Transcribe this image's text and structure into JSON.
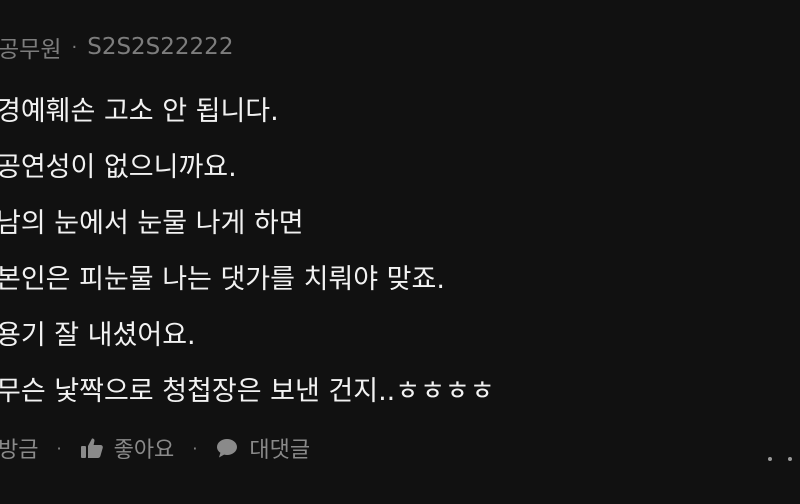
{
  "comment": {
    "author": "공무원",
    "separator": "·",
    "user_id": "S2S2S22222",
    "lines": [
      "경예훼손 고소 안 됩니다.",
      "공연성이 없으니까요.",
      "남의 눈에서 눈물 나게 하면",
      "본인은 피눈물 나는 댓가를 치뤄야 맞죠.",
      "용기 잘 내셨어요.",
      "무슨 낯짝으로 청첩장은 보낸 건지..ㅎㅎㅎㅎ"
    ],
    "timestamp": "방금",
    "like_label": "좋아요",
    "reply_label": "대댓글",
    "icons": {
      "like": "thumbs-up-icon",
      "reply": "speech-bubble-icon",
      "more": "more-dots-icon"
    },
    "colors": {
      "background": "#111111",
      "text": "#f2f2f2",
      "meta": "#7d7d7d"
    }
  }
}
